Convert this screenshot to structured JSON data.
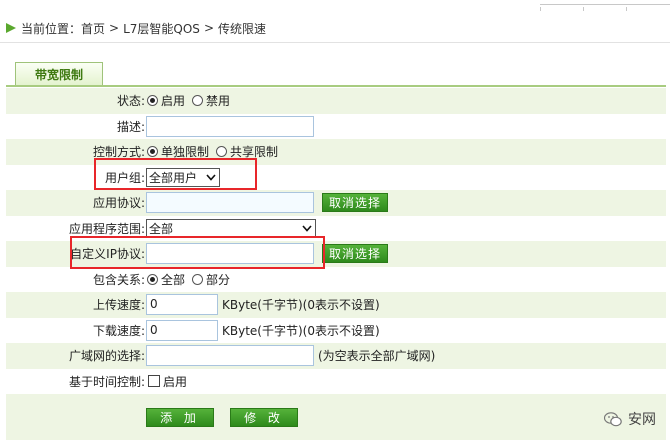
{
  "breadcrumb": {
    "prefix": "当前位置：",
    "items": [
      "首页",
      "L7层智能QOS",
      "传统限速"
    ],
    "separator": ">"
  },
  "tab": {
    "label": "带宽限制"
  },
  "form": {
    "status": {
      "label": "状态:",
      "options": [
        "启用",
        "禁用"
      ],
      "selected": "启用"
    },
    "description": {
      "label": "描述:",
      "value": ""
    },
    "control_mode": {
      "label": "控制方式:",
      "options": [
        "单独限制",
        "共享限制"
      ],
      "selected": "单独限制"
    },
    "user_group": {
      "label": "用户组:",
      "value": "全部用户"
    },
    "app_protocol": {
      "label": "应用协议:",
      "value": "",
      "clear_button": "取消选择"
    },
    "app_scope": {
      "label": "应用程序范围:",
      "value": "全部"
    },
    "custom_ip": {
      "label": "自定义IP协议:",
      "value": "",
      "clear_button": "取消选择"
    },
    "contain": {
      "label": "包含关系:",
      "options": [
        "全部",
        "部分"
      ],
      "selected": "全部"
    },
    "upload": {
      "label": "上传速度:",
      "value": "0",
      "unit": "KByte(千字节)(0表示不设置)"
    },
    "download": {
      "label": "下载速度:",
      "value": "0",
      "unit": "KByte(千字节)(0表示不设置)"
    },
    "wan": {
      "label": "广域网的选择:",
      "value": "",
      "note": "(为空表示全部广域网)"
    },
    "time_control": {
      "label": "基于时间控制:",
      "checkbox_label": "启用",
      "checked": false
    }
  },
  "buttons": {
    "add": "添 加",
    "modify": "修 改"
  },
  "watermark": {
    "text": "安网",
    "icon": "wechat-icon"
  },
  "colors": {
    "accent_green": "#3c9a24",
    "highlight_red": "#e8262a",
    "row_alt": "#eef5e3"
  }
}
